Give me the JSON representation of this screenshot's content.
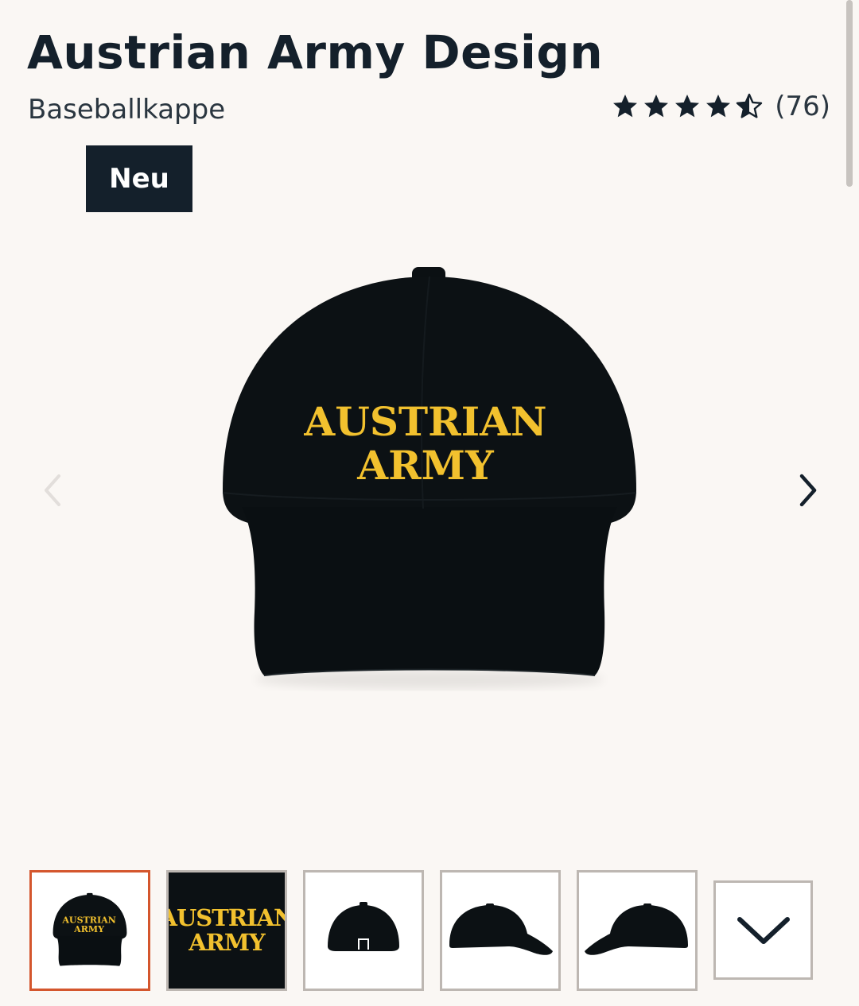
{
  "product": {
    "title": "Austrian Army Design",
    "subtitle": "Baseballkappe",
    "rating": 4.5,
    "review_count": "(76)",
    "badge": "Neu",
    "print_text_line1": "AUSTRIAN",
    "print_text_line2": "ARMY"
  },
  "gallery": {
    "prev_icon": "chevron-left-icon",
    "next_icon": "chevron-right-icon",
    "more_icon": "chevron-down-icon",
    "active_index": 0,
    "thumbnails": [
      {
        "view": "front",
        "active": true
      },
      {
        "view": "print-detail",
        "active": false
      },
      {
        "view": "back",
        "active": false
      },
      {
        "view": "side-right",
        "active": false
      },
      {
        "view": "side-left",
        "active": false
      }
    ]
  },
  "colors": {
    "accent": "#d4562d",
    "dark": "#14202b",
    "print_yellow": "#f2c12e",
    "cap": "#0c1114",
    "background": "#faf7f4"
  }
}
